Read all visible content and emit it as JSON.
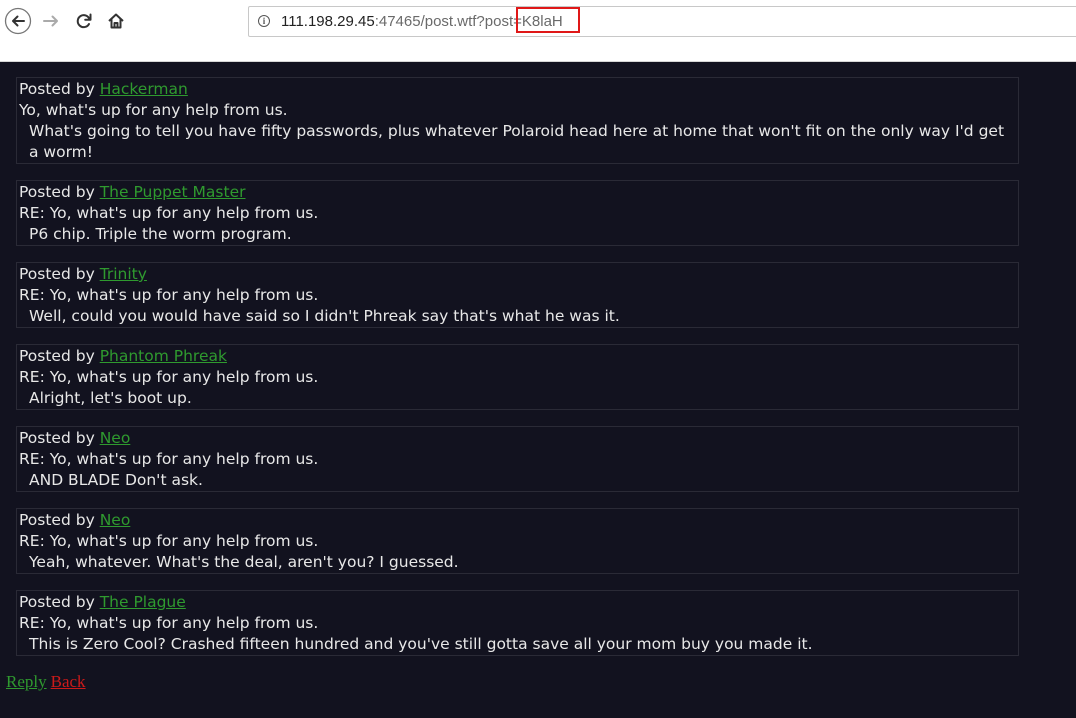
{
  "browser": {
    "url_host": "111.198.29.45",
    "url_port_path": ":47465/post.wtf?post=",
    "url_param": "K8laH"
  },
  "posts": [
    {
      "prefix": "Posted by",
      "author": "Hackerman",
      "title": "Yo, what's up for any help from us.",
      "body": "What's going to tell you have fifty passwords, plus whatever Polaroid head here at home that won't fit on the only way I'd get a worm!"
    },
    {
      "prefix": "Posted by",
      "author": "The Puppet Master",
      "title": "RE: Yo, what's up for any help from us.",
      "body": "P6 chip. Triple the worm program."
    },
    {
      "prefix": "Posted by",
      "author": "Trinity",
      "title": "RE: Yo, what's up for any help from us.",
      "body": "Well, could you would have said so I didn't Phreak say that's what he was it."
    },
    {
      "prefix": "Posted by",
      "author": "Phantom Phreak",
      "title": "RE: Yo, what's up for any help from us.",
      "body": "Alright, let's boot up."
    },
    {
      "prefix": "Posted by",
      "author": "Neo",
      "title": "RE: Yo, what's up for any help from us.",
      "body": "AND BLADE Don't ask."
    },
    {
      "prefix": "Posted by",
      "author": "Neo",
      "title": "RE: Yo, what's up for any help from us.",
      "body": "Yeah, whatever. What's the deal, aren't you? I guessed."
    },
    {
      "prefix": "Posted by",
      "author": "The Plague",
      "title": "RE: Yo, what's up for any help from us.",
      "body": "This is Zero Cool? Crashed fifteen hundred and you've still gotta save all your mom buy you made it."
    }
  ],
  "footer": {
    "reply_label": "Reply",
    "back_label": "Back"
  },
  "icons": [
    "back-arrow-icon",
    "forward-arrow-icon",
    "reload-icon",
    "home-icon",
    "info-icon"
  ],
  "colors": {
    "link_green": "#2f9a2f",
    "link_red": "#cc1a1a",
    "page_bg": "#12121f"
  }
}
